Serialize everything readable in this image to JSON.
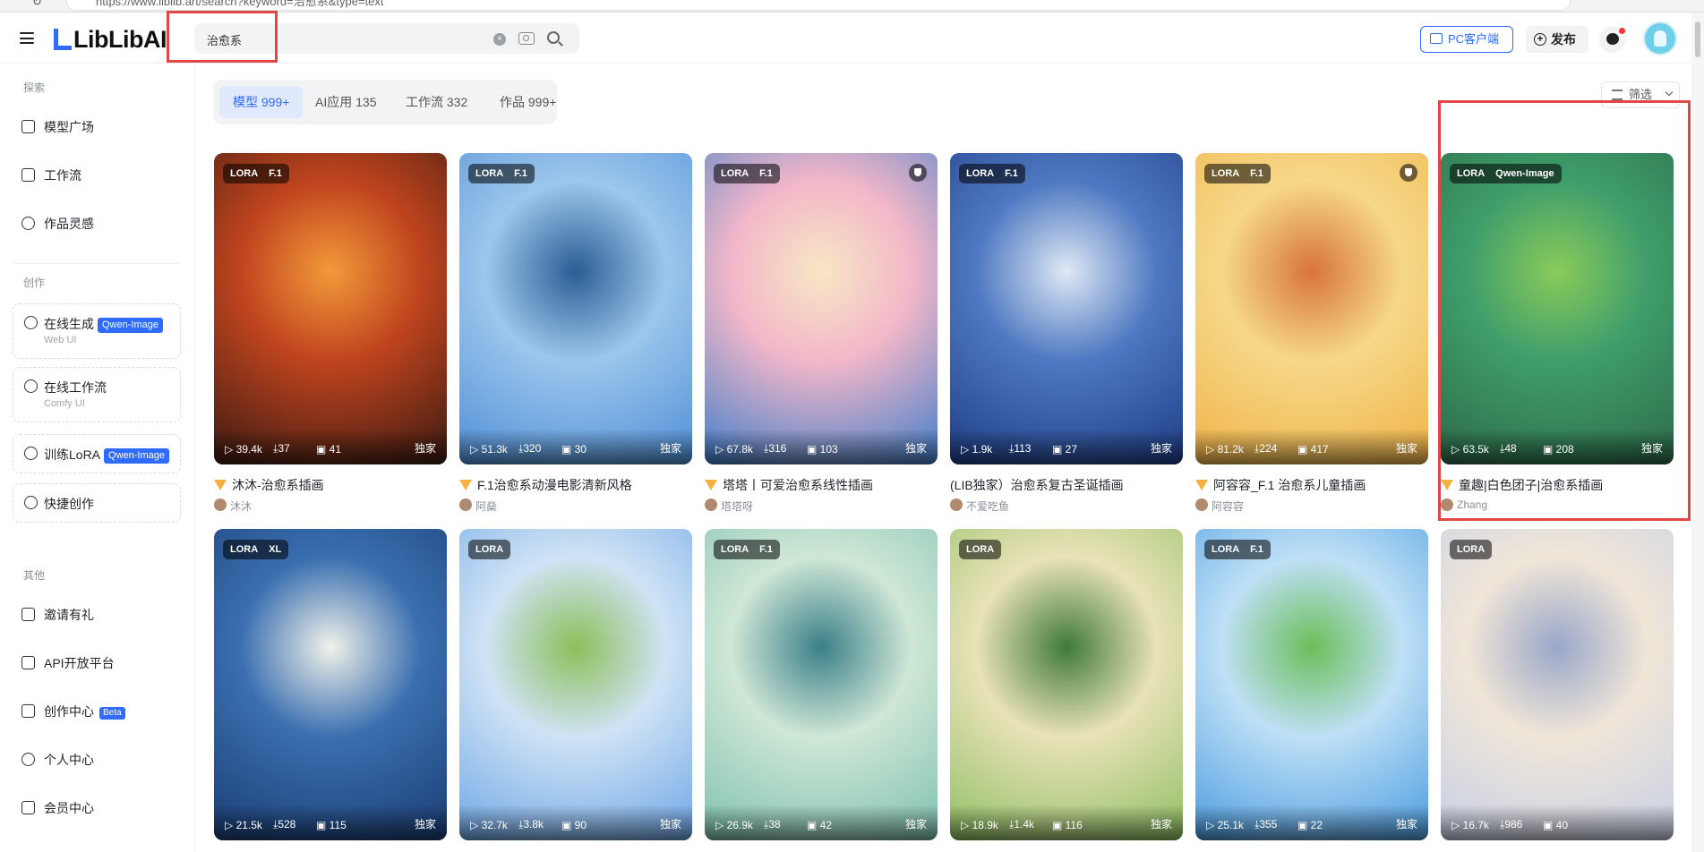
{
  "browser": {
    "url": "https://www.liblib.art/search?keyword=治愈系&type=text"
  },
  "header": {
    "logo": "LibLib",
    "logo_ai": "AI",
    "search_value": "治愈系",
    "pc_client_label": "PC客户端",
    "publish_label": "发布"
  },
  "sidebar": {
    "section_explore": "探索",
    "section_create": "创作",
    "section_other": "其他",
    "explore_items": [
      {
        "label": "模型广场",
        "icon": "home-icon"
      },
      {
        "label": "工作流",
        "icon": "workflow-icon"
      },
      {
        "label": "作品灵感",
        "icon": "bulb-icon"
      }
    ],
    "create_cards": [
      {
        "label": "在线生成",
        "tag": "Qwen-Image",
        "sub": "Web UI"
      },
      {
        "label": "在线工作流",
        "tag": "",
        "sub": "Comfy UI"
      },
      {
        "label": "训练LoRA",
        "tag": "Qwen-Image",
        "sub": ""
      },
      {
        "label": "快捷创作",
        "tag": "",
        "sub": ""
      }
    ],
    "other_items": [
      {
        "label": "邀请有礼",
        "icon": "gift-icon",
        "tag": ""
      },
      {
        "label": "API开放平台",
        "icon": "api-icon",
        "tag": ""
      },
      {
        "label": "创作中心",
        "icon": "pen-icon",
        "tag": "Beta"
      },
      {
        "label": "个人中心",
        "icon": "user-icon",
        "tag": ""
      },
      {
        "label": "会员中心",
        "icon": "vip-icon",
        "tag": ""
      }
    ]
  },
  "tabs": [
    {
      "label": "模型 999+",
      "active": true
    },
    {
      "label": "AI应用 135",
      "active": false
    },
    {
      "label": "工作流 332",
      "active": false
    },
    {
      "label": "作品 999+",
      "active": false
    }
  ],
  "filter_label": "筛选",
  "cards": [
    {
      "tags": [
        "LORA",
        "F.1"
      ],
      "shield": false,
      "views": "39.4k",
      "downloads": "37",
      "images": "41",
      "exclusive": "独家",
      "name": "沐沐-治愈系插画",
      "medal": true,
      "author": "沐沐",
      "palette": [
        "#3a1a12",
        "#c0441e",
        "#f29a3a"
      ]
    },
    {
      "tags": [
        "LORA",
        "F.1"
      ],
      "shield": false,
      "views": "51.3k",
      "downloads": "320",
      "images": "30",
      "exclusive": "独家",
      "name": "F.1治愈系动漫电影清新风格",
      "medal": true,
      "author": "阿燊",
      "palette": [
        "#4f8fd8",
        "#9cc6ec",
        "#2b5d94"
      ]
    },
    {
      "tags": [
        "LORA",
        "F.1"
      ],
      "shield": true,
      "views": "67.8k",
      "downloads": "316",
      "images": "103",
      "exclusive": "独家",
      "name": "塔塔丨可爱治愈系线性插画",
      "medal": true,
      "author": "塔塔呀",
      "palette": [
        "#3f7ec9",
        "#f3b7c9",
        "#f7e7c4"
      ]
    },
    {
      "tags": [
        "LORA",
        "F.1"
      ],
      "shield": false,
      "views": "1.9k",
      "downloads": "113",
      "images": "27",
      "exclusive": "独家",
      "name": "(LIB独家）治愈系复古圣诞插画",
      "medal": false,
      "author": "不爱吃鱼",
      "palette": [
        "#1d3d86",
        "#4f79c2",
        "#dfe9f4"
      ]
    },
    {
      "tags": [
        "LORA",
        "F.1"
      ],
      "shield": true,
      "views": "81.2k",
      "downloads": "224",
      "images": "417",
      "exclusive": "独家",
      "name": "阿容容_F.1 治愈系儿童插画",
      "medal": true,
      "author": "阿容容",
      "palette": [
        "#f0b347",
        "#f6d88a",
        "#d8743c"
      ]
    },
    {
      "tags": [
        "LORA",
        "Qwen-Image"
      ],
      "shield": false,
      "views": "63.5k",
      "downloads": "48",
      "images": "208",
      "exclusive": "独家",
      "name": "童趣|白色团子|治愈系插画",
      "medal": true,
      "author": "Zhang",
      "palette": [
        "#2d6a4a",
        "#3f9e6b",
        "#8acb5a"
      ]
    },
    {
      "tags": [
        "LORA",
        "XL"
      ],
      "shield": false,
      "views": "21.5k",
      "downloads": "528",
      "images": "115",
      "exclusive": "独家",
      "name": "",
      "medal": false,
      "author": "",
      "palette": [
        "#1b3d73",
        "#3a6fb0",
        "#f2f2ea"
      ]
    },
    {
      "tags": [
        "LORA"
      ],
      "shield": false,
      "views": "32.7k",
      "downloads": "3.8k",
      "images": "90",
      "exclusive": "独家",
      "name": "",
      "medal": false,
      "author": "",
      "palette": [
        "#6fa7e6",
        "#cfe3f5",
        "#8cbf5a"
      ]
    },
    {
      "tags": [
        "LORA",
        "F.1"
      ],
      "shield": false,
      "views": "26.9k",
      "downloads": "38",
      "images": "42",
      "exclusive": "独家",
      "name": "",
      "medal": false,
      "author": "",
      "palette": [
        "#7ec0b0",
        "#cfe7d6",
        "#3a7f88"
      ]
    },
    {
      "tags": [
        "LORA"
      ],
      "shield": false,
      "views": "18.9k",
      "downloads": "1.4k",
      "images": "116",
      "exclusive": "独家",
      "name": "",
      "medal": false,
      "author": "",
      "palette": [
        "#8fbf63",
        "#e9e2b8",
        "#3f7a3a"
      ]
    },
    {
      "tags": [
        "LORA",
        "F.1"
      ],
      "shield": false,
      "views": "25.1k",
      "downloads": "355",
      "images": "22",
      "exclusive": "独家",
      "name": "",
      "medal": false,
      "author": "",
      "palette": [
        "#4a9be0",
        "#bfe0f6",
        "#6bbf5a"
      ]
    },
    {
      "tags": [
        "LORA"
      ],
      "shield": false,
      "views": "16.7k",
      "downloads": "986",
      "images": "40",
      "exclusive": "",
      "name": "",
      "medal": false,
      "author": "",
      "palette": [
        "#c7cfe6",
        "#f0e6d8",
        "#9aa7c9"
      ]
    }
  ]
}
